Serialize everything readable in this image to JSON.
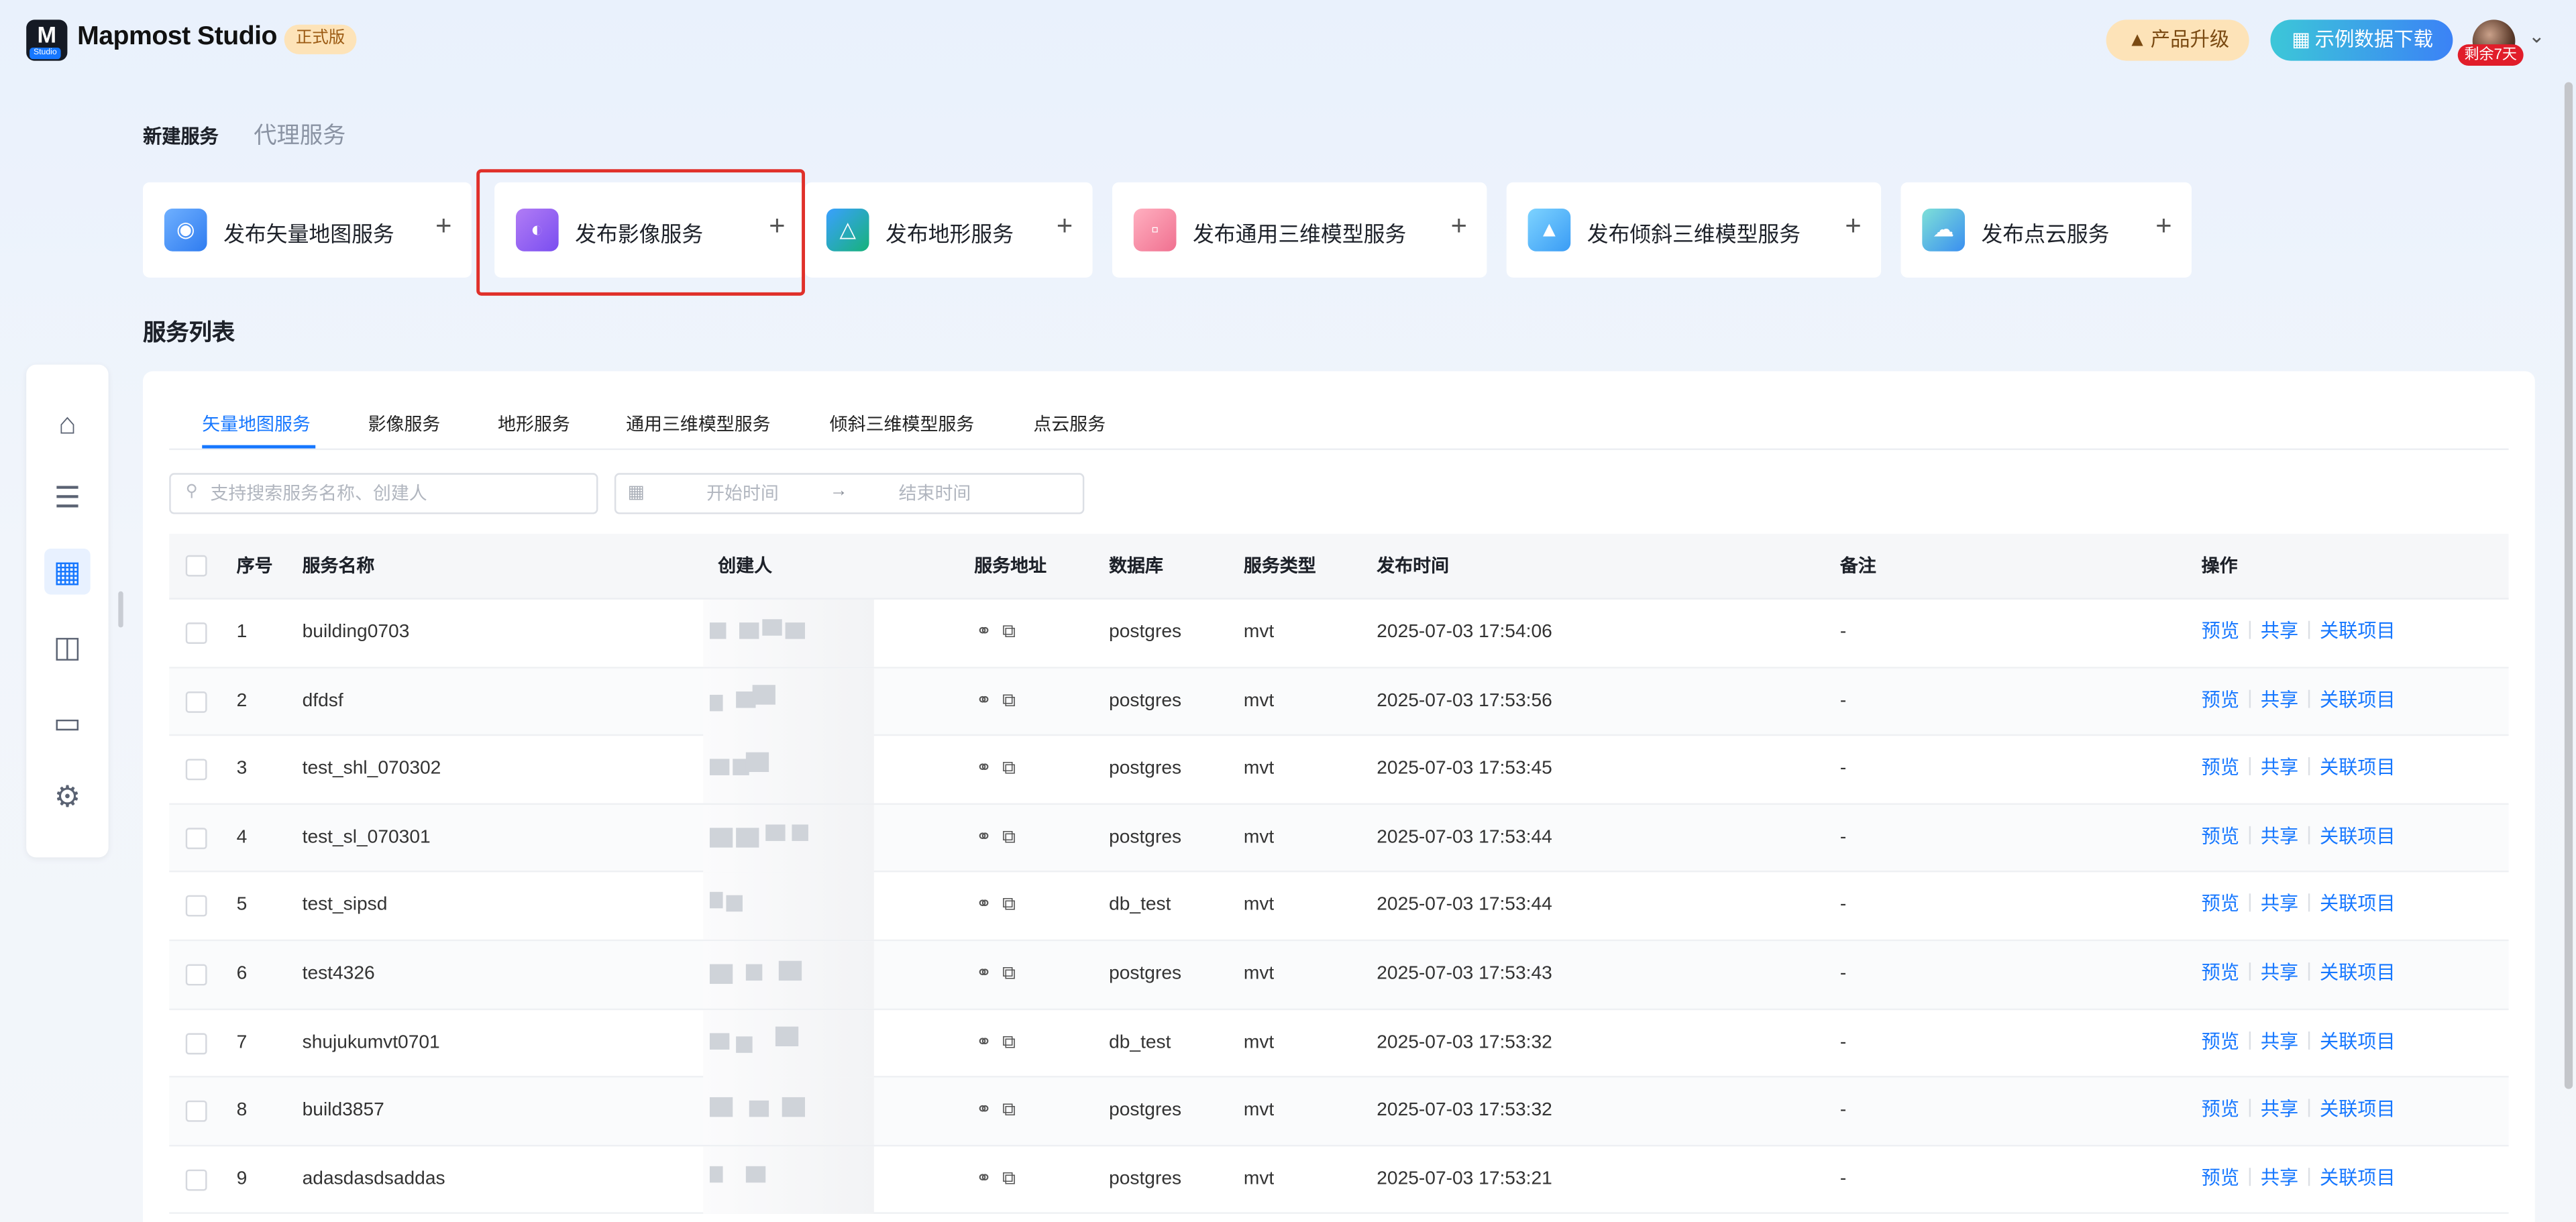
{
  "header": {
    "brand": "Mapmost Studio",
    "logo_text": "Studio",
    "edition": "正式版",
    "upgrade_label": "产品升级",
    "download_label": "示例数据下载",
    "remaining_badge": "剩余7天",
    "colors": {
      "accent": "#1677ff",
      "upgrade_bg": "#fde3b8",
      "remain_bg": "#e11d2a"
    }
  },
  "section_tabs": [
    "新建服务",
    "代理服务"
  ],
  "publish_cards": [
    {
      "label": "发布矢量地图服务",
      "icon": "globe-icon"
    },
    {
      "label": "发布影像服务",
      "icon": "earth-image-icon"
    },
    {
      "label": "发布地形服务",
      "icon": "terrain-icon"
    },
    {
      "label": "发布通用三维模型服务",
      "icon": "cube-icon"
    },
    {
      "label": "发布倾斜三维模型服务",
      "icon": "oblique-model-icon"
    },
    {
      "label": "发布点云服务",
      "icon": "cloud-icon"
    }
  ],
  "list_title": "服务列表",
  "sidebar": {
    "items": [
      "home-icon",
      "database-icon",
      "grid-apps-icon",
      "map-icon",
      "folder-icon",
      "settings-icon"
    ],
    "active": 2
  },
  "service_tabs": [
    "矢量地图服务",
    "影像服务",
    "地形服务",
    "通用三维模型服务",
    "倾斜三维模型服务",
    "点云服务"
  ],
  "filters": {
    "search_placeholder": "支持搜索服务名称、创建人",
    "start_placeholder": "开始时间",
    "end_placeholder": "结束时间"
  },
  "table": {
    "columns": [
      "序号",
      "服务名称",
      "创建人",
      "服务地址",
      "数据库",
      "服务类型",
      "发布时间",
      "备注",
      "操作"
    ],
    "actions": [
      "预览",
      "共享",
      "关联项目"
    ],
    "rows": [
      {
        "no": "1",
        "name": "building0703",
        "db": "postgres",
        "type": "mvt",
        "time": "2025-07-03 17:54:06",
        "note": "-"
      },
      {
        "no": "2",
        "name": "dfdsf",
        "db": "postgres",
        "type": "mvt",
        "time": "2025-07-03 17:53:56",
        "note": "-"
      },
      {
        "no": "3",
        "name": "test_shl_070302",
        "db": "postgres",
        "type": "mvt",
        "time": "2025-07-03 17:53:45",
        "note": "-"
      },
      {
        "no": "4",
        "name": "test_sl_070301",
        "db": "postgres",
        "type": "mvt",
        "time": "2025-07-03 17:53:44",
        "note": "-"
      },
      {
        "no": "5",
        "name": "test_sipsd",
        "db": "db_test",
        "type": "mvt",
        "time": "2025-07-03 17:53:44",
        "note": "-"
      },
      {
        "no": "6",
        "name": "test4326",
        "db": "postgres",
        "type": "mvt",
        "time": "2025-07-03 17:53:43",
        "note": "-"
      },
      {
        "no": "7",
        "name": "shujukumvt0701",
        "db": "db_test",
        "type": "mvt",
        "time": "2025-07-03 17:53:32",
        "note": "-"
      },
      {
        "no": "8",
        "name": "build3857",
        "db": "postgres",
        "type": "mvt",
        "time": "2025-07-03 17:53:32",
        "note": "-"
      },
      {
        "no": "9",
        "name": "adasdasdsaddas",
        "db": "postgres",
        "type": "mvt",
        "time": "2025-07-03 17:53:21",
        "note": "-"
      }
    ]
  }
}
